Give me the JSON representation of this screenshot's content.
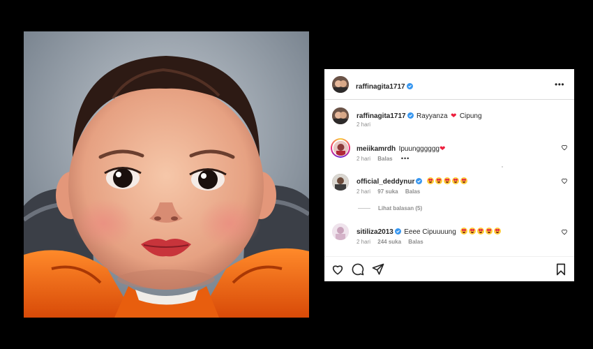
{
  "post": {
    "author": "raffinagita1717",
    "caption_author": "raffinagita1717",
    "caption_text_1": "Rayyanza",
    "caption_text_2": "Cipung",
    "caption_time": "2 hari",
    "more_menu": "•••"
  },
  "comments": [
    {
      "username": "meiikamrdh",
      "text": "Ipuungggggg",
      "time": "2 hari",
      "reply_label": "Balas",
      "options": "•••"
    },
    {
      "username": "official_deddynur",
      "text": "",
      "time": "2 hari",
      "likes": "97 suka",
      "reply_label": "Balas",
      "view_replies": "Lihat balasan (5)"
    },
    {
      "username": "sitiliza2013",
      "text": "Eeee Cipuuuung",
      "time": "2 hari",
      "likes": "244 suka",
      "reply_label": "Balas"
    }
  ],
  "icons": {
    "verified": "verified-badge-icon",
    "like": "heart-icon",
    "comment": "comment-icon",
    "share": "paper-plane-icon",
    "save": "bookmark-icon",
    "emoji": "heart-eyes-emoji-icon"
  },
  "colors": {
    "verified_blue": "#3897f0",
    "heart_red": "#ed1e3d",
    "muted_text": "#8e8e8e",
    "jacket_orange": "#f26a10"
  }
}
